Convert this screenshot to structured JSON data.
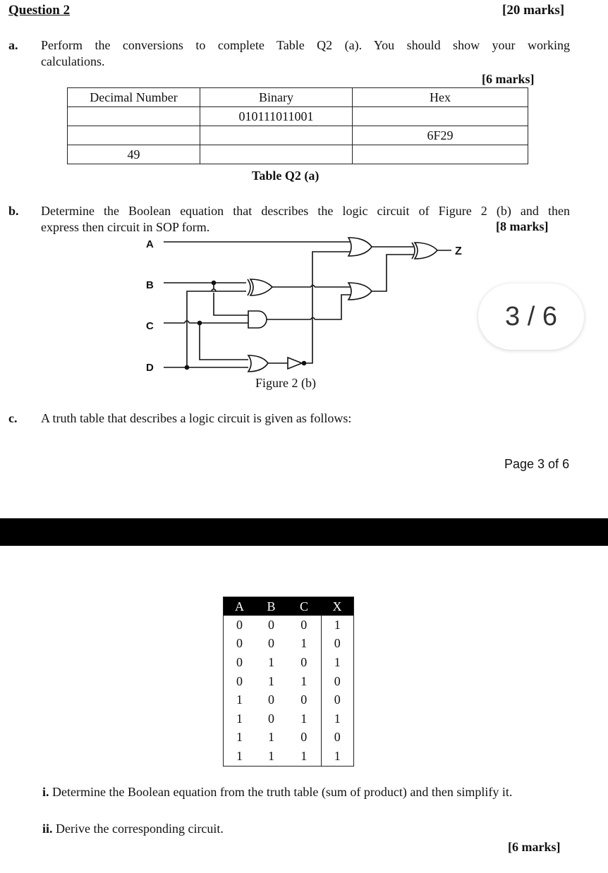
{
  "header": {
    "question_title": "Question 2",
    "question_marks": "[20 marks]"
  },
  "part_a": {
    "label": "a.",
    "text_line1": "Perform the conversions to complete Table Q2 (a). You should show your working",
    "text_line2": "calculations.",
    "marks": "[6 marks]",
    "table": {
      "headers": [
        "Decimal Number",
        "Binary",
        "Hex"
      ],
      "rows": [
        [
          "",
          "010111011001",
          ""
        ],
        [
          "",
          "",
          "6F29"
        ],
        [
          "49",
          "",
          ""
        ]
      ]
    },
    "caption": "Table Q2 (a)"
  },
  "part_b": {
    "label": "b.",
    "text_line1": "Determine the Boolean equation that describes the logic circuit of Figure 2 (b) and then",
    "text_line2": "express then circuit in SOP form.",
    "marks": "[8 marks]",
    "figure": {
      "inputs": [
        "A",
        "B",
        "C",
        "D"
      ],
      "output": "Z",
      "gates": [
        "xor-gate",
        "and-gate",
        "or-gate",
        "not-gate",
        "or-gate",
        "or-gate",
        "xor-gate"
      ],
      "caption": "Figure 2 (b)"
    }
  },
  "pager": {
    "current": 3,
    "total": 6,
    "text": "3 / 6"
  },
  "part_c": {
    "label": "c.",
    "text": "A truth table that describes a logic circuit is given as follows:",
    "page_footer": "Page 3 of 6",
    "truth_table": {
      "headers": [
        "A",
        "B",
        "C",
        "X"
      ],
      "rows": [
        [
          "0",
          "0",
          "0",
          "1"
        ],
        [
          "0",
          "0",
          "1",
          "0"
        ],
        [
          "0",
          "1",
          "0",
          "1"
        ],
        [
          "0",
          "1",
          "1",
          "0"
        ],
        [
          "1",
          "0",
          "0",
          "0"
        ],
        [
          "1",
          "0",
          "1",
          "1"
        ],
        [
          "1",
          "1",
          "0",
          "0"
        ],
        [
          "1",
          "1",
          "1",
          "1"
        ]
      ]
    },
    "sub_i_label": "i.",
    "sub_i_text": " Determine the Boolean equation from the truth table (sum of product) and then simplify it.",
    "sub_ii_label": "ii.",
    "sub_ii_text": " Derive the corresponding circuit.",
    "marks": "[6 marks]"
  }
}
